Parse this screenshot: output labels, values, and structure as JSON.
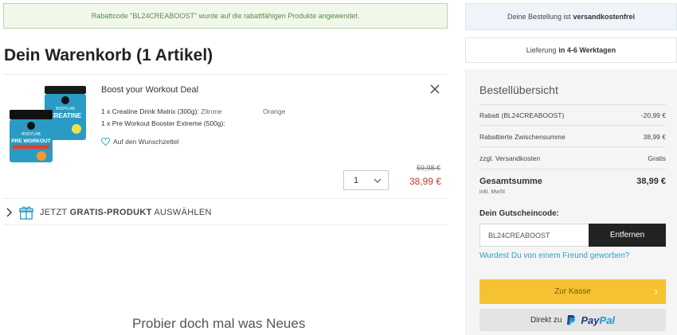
{
  "banner": {
    "text": "Rabattcode \"BL24CREABOOST\" wurde auf die rabattfähigen Produkte angewendet."
  },
  "cart": {
    "title": "Dein Warenkorb (1 Artikel)"
  },
  "product": {
    "name": "Boost your Workout Deal",
    "line1_label": "1 x Creatine Drink Matrix (300g):",
    "line1_option": "Zitrone",
    "line1_option2": "Orange",
    "line2_label": "1 x Pre Workout Booster Extreme (500g):",
    "wishlist": "Auf den Wunschzettel",
    "quantity": "1",
    "old_price": "59,98 €",
    "new_price": "38,99 €",
    "image_brand": "BODYLAB",
    "image_label_front": "PRE WORKOUT",
    "image_label_back": "CREATINE"
  },
  "gratis": {
    "prefix": "JETZT",
    "bold": "GRATIS-PRODUKT",
    "suffix": "AUSWÄHLEN"
  },
  "probier": {
    "text": "Probier doch mal was Neues"
  },
  "sidebar": {
    "shipping_prefix": "Deine Bestellung ist",
    "shipping_bold": "versandkostenfrei",
    "delivery_prefix": "Lieferung",
    "delivery_bold": "in 4-6 Werktagen",
    "summary_title": "Bestellübersicht",
    "rows": [
      {
        "label": "Rabatt (BL24CREABOOST)",
        "value": "-20,99 €"
      },
      {
        "label": "Rabattierte Zwischensumme",
        "value": "38,99 €"
      },
      {
        "label": "zzgl. Versandkosten",
        "value": "Gratis"
      }
    ],
    "total_label": "Gesamtsumme",
    "total_value": "38,99 €",
    "mwst": "inkl. MwSt",
    "voucher_label": "Dein Gutscheincode:",
    "voucher_value": "BL24CREABOOST",
    "remove_label": "Entfernen",
    "referral": "Wurdest Du von einem Freund geworben?",
    "checkout_label": "Zur Kasse",
    "paypal_prefix": "Direkt zu",
    "paypal_pay": "Pay",
    "paypal_pal": "Pal"
  },
  "colors": {
    "accent_yellow": "#f6c232",
    "price_red": "#c0392b",
    "link_blue": "#2aa0c8",
    "banner_green": "#5b8a3c"
  }
}
